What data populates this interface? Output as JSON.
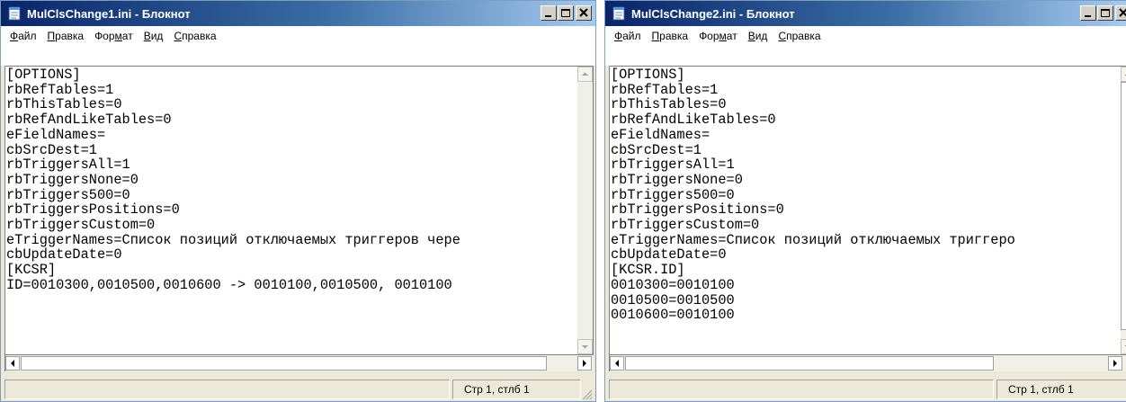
{
  "windows": [
    {
      "title": "MulClsChange1.ini - Блокнот",
      "menu": [
        {
          "accel": "Ф",
          "rest": "айл"
        },
        {
          "accel": "П",
          "rest": "равка"
        },
        {
          "pre": "Фор",
          "accel": "м",
          "rest": "ат"
        },
        {
          "accel": "В",
          "rest": "ид"
        },
        {
          "accel": "С",
          "rest": "правка"
        }
      ],
      "lines": [
        "[OPTIONS]",
        "rbRefTables=1",
        "rbThisTables=0",
        "rbRefAndLikeTables=0",
        "eFieldNames=",
        "cbSrcDest=1",
        "rbTriggersAll=1",
        "rbTriggersNone=0",
        "rbTriggers500=0",
        "rbTriggersPositions=0",
        "rbTriggersCustom=0",
        "eTriggerNames=Список позиций отключаемых триггеров чере",
        "cbUpdateDate=0",
        "[KCSR]",
        "ID=0010300,0010500,0010600 -> 0010100,0010500, 0010100"
      ],
      "status": "Стр 1, стлб 1"
    },
    {
      "title": "MulClsChange2.ini - Блокнот",
      "menu": [
        {
          "accel": "Ф",
          "rest": "айл"
        },
        {
          "accel": "П",
          "rest": "равка"
        },
        {
          "pre": "Фор",
          "accel": "м",
          "rest": "ат"
        },
        {
          "accel": "В",
          "rest": "ид"
        },
        {
          "accel": "С",
          "rest": "правка"
        }
      ],
      "lines": [
        "[OPTIONS]",
        "rbRefTables=1",
        "rbThisTables=0",
        "rbRefAndLikeTables=0",
        "eFieldNames=",
        "cbSrcDest=1",
        "rbTriggersAll=1",
        "rbTriggersNone=0",
        "rbTriggers500=0",
        "rbTriggersPositions=0",
        "rbTriggersCustom=0",
        "eTriggerNames=Список позиций отключаемых триггеро",
        "cbUpdateDate=0",
        "[KCSR.ID]",
        "0010300=0010100",
        "0010500=0010500",
        "0010600=0010100"
      ],
      "status": "Стр 1, стлб 1"
    }
  ],
  "icons": {
    "app": "notepad-icon",
    "minimize": "minimize-icon",
    "maximize": "maximize-icon",
    "close": "close-icon"
  },
  "colors": {
    "titlebar_start": "#0a246a",
    "titlebar_end": "#a6caf0",
    "chrome": "#ece9d8"
  }
}
